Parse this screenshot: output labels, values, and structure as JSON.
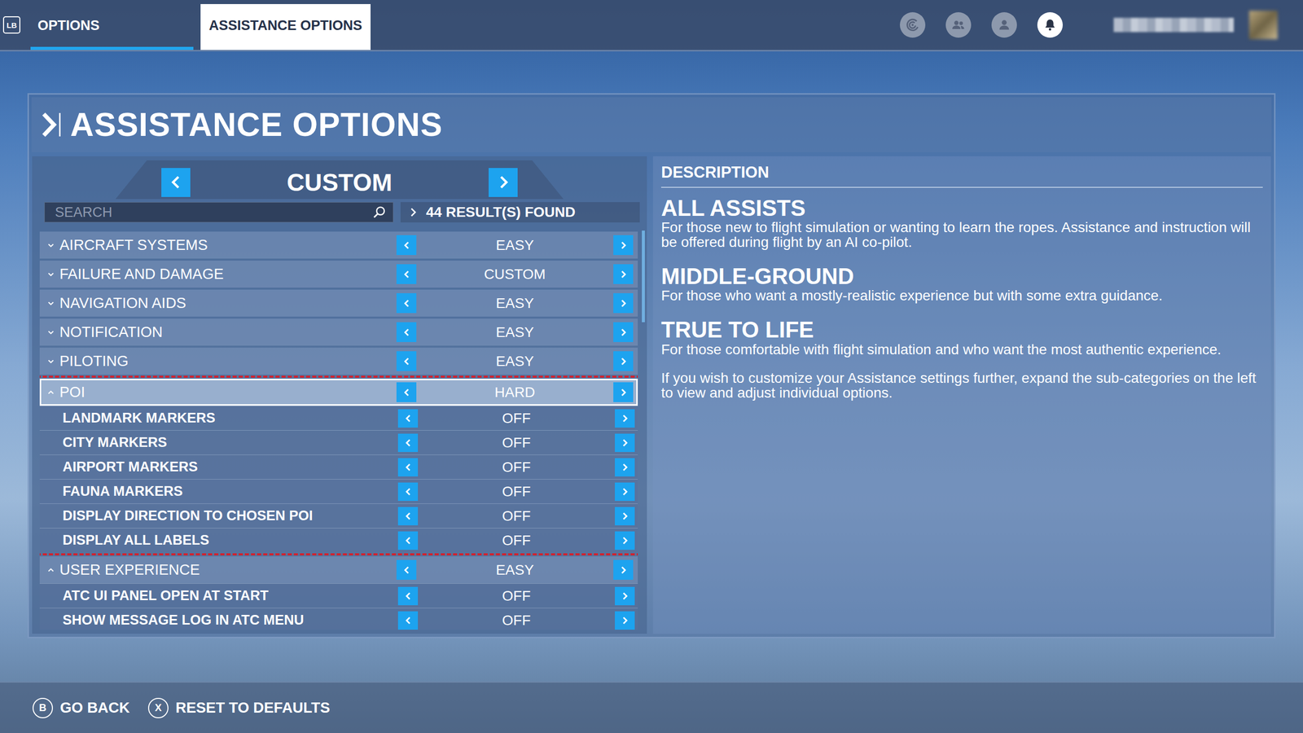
{
  "top_bar": {
    "bumper": "LB",
    "tabs": [
      {
        "label": "OPTIONS",
        "selected": false,
        "underlined": true
      },
      {
        "label": "ASSISTANCE OPTIONS",
        "selected": true,
        "underlined": false
      }
    ],
    "icons": [
      {
        "kind": "activity",
        "selected": false
      },
      {
        "kind": "friends",
        "selected": false
      },
      {
        "kind": "profile",
        "selected": false
      },
      {
        "kind": "notifications",
        "selected": true
      }
    ]
  },
  "panel": {
    "title": "ASSISTANCE OPTIONS"
  },
  "preset": {
    "label": "CUSTOM"
  },
  "search": {
    "placeholder": "SEARCH",
    "results": "44 RESULT(S) FOUND"
  },
  "categories": [
    {
      "name": "AIRCRAFT SYSTEMS",
      "value": "EASY",
      "expanded": false,
      "selected": false,
      "highlighted": false,
      "options": []
    },
    {
      "name": "FAILURE AND DAMAGE",
      "value": "CUSTOM",
      "expanded": false,
      "selected": false,
      "highlighted": false,
      "options": []
    },
    {
      "name": "NAVIGATION AIDS",
      "value": "EASY",
      "expanded": false,
      "selected": false,
      "highlighted": false,
      "options": []
    },
    {
      "name": "NOTIFICATION",
      "value": "EASY",
      "expanded": false,
      "selected": false,
      "highlighted": false,
      "options": []
    },
    {
      "name": "PILOTING",
      "value": "EASY",
      "expanded": false,
      "selected": false,
      "highlighted": false,
      "options": []
    },
    {
      "name": "POI",
      "value": "HARD",
      "expanded": true,
      "selected": true,
      "highlighted": true,
      "options": [
        {
          "name": "LANDMARK MARKERS",
          "value": "OFF"
        },
        {
          "name": "CITY MARKERS",
          "value": "OFF"
        },
        {
          "name": "AIRPORT MARKERS",
          "value": "OFF"
        },
        {
          "name": "FAUNA MARKERS",
          "value": "OFF"
        },
        {
          "name": "DISPLAY DIRECTION TO CHOSEN POI",
          "value": "OFF"
        },
        {
          "name": "DISPLAY ALL LABELS",
          "value": "OFF"
        }
      ]
    },
    {
      "name": "USER EXPERIENCE",
      "value": "EASY",
      "expanded": true,
      "selected": false,
      "highlighted": false,
      "options": [
        {
          "name": "ATC UI PANEL OPEN AT START",
          "value": "OFF"
        },
        {
          "name": "SHOW MESSAGE LOG IN ATC MENU",
          "value": "OFF"
        }
      ]
    }
  ],
  "description": {
    "heading": "DESCRIPTION",
    "sections": [
      {
        "title": "ALL ASSISTS",
        "text": "For those new to flight simulation or wanting to learn the ropes. Assistance and instruction will be offered during flight by an AI co-pilot."
      },
      {
        "title": "MIDDLE-GROUND",
        "text": "For those who want a mostly-realistic experience but with some extra guidance."
      },
      {
        "title": "TRUE TO LIFE",
        "text": "For those comfortable with flight simulation and who want the most authentic experience."
      }
    ],
    "note": "If you wish to customize your Assistance settings further, expand the sub-categories on the left to view and adjust individual options."
  },
  "footer": {
    "buttons": [
      {
        "key": "B",
        "label": "GO BACK"
      },
      {
        "key": "X",
        "label": "RESET TO DEFAULTS"
      }
    ]
  }
}
